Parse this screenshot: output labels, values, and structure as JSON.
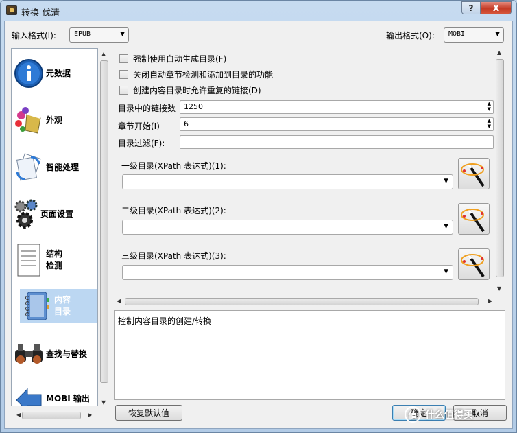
{
  "window": {
    "title": "转换 伐清",
    "help": "?",
    "close": "X"
  },
  "formats": {
    "input_label": "输入格式(I):",
    "input_value": "EPUB",
    "output_label": "输出格式(O):",
    "output_value": "MOBI"
  },
  "sidebar": {
    "items": [
      {
        "label": "元数据",
        "icon": "info-icon"
      },
      {
        "label": "外观",
        "icon": "paint-bucket-icon"
      },
      {
        "label": "智能处理",
        "icon": "heuristics-icon"
      },
      {
        "label": "页面设置",
        "icon": "gears-icon"
      },
      {
        "label": "结构\n检测",
        "icon": "document-icon"
      },
      {
        "label": "内容\n目录",
        "icon": "notebook-icon"
      },
      {
        "label": "查找与替换",
        "icon": "binoculars-icon"
      },
      {
        "label": "MOBI 输出",
        "icon": "arrow-left-icon"
      }
    ],
    "selected": 5
  },
  "options": {
    "force_auto_toc": "强制使用自动生成目录(F)",
    "no_chapters_in_toc": "关闭自动章节检测和添加到目录的功能",
    "allow_duplicate_links": "创建内容目录时允许重复的链接(D)",
    "max_links_label": "目录中的链接数",
    "max_links_value": "1250",
    "chapter_threshold_label": "章节开始(I)",
    "chapter_threshold_value": "6",
    "toc_filter_label": "目录过滤(F):",
    "toc_filter_value": "",
    "level1_label": "一级目录(XPath 表达式)(1):",
    "level2_label": "二级目录(XPath 表达式)(2):",
    "level3_label": "三级目录(XPath 表达式)(3):"
  },
  "description": "控制内容目录的创建/转换",
  "buttons": {
    "restore_defaults": "恢复默认值",
    "ok": "确定",
    "cancel": "取消"
  },
  "watermark": {
    "badge": "值",
    "text": "什么值得买"
  }
}
